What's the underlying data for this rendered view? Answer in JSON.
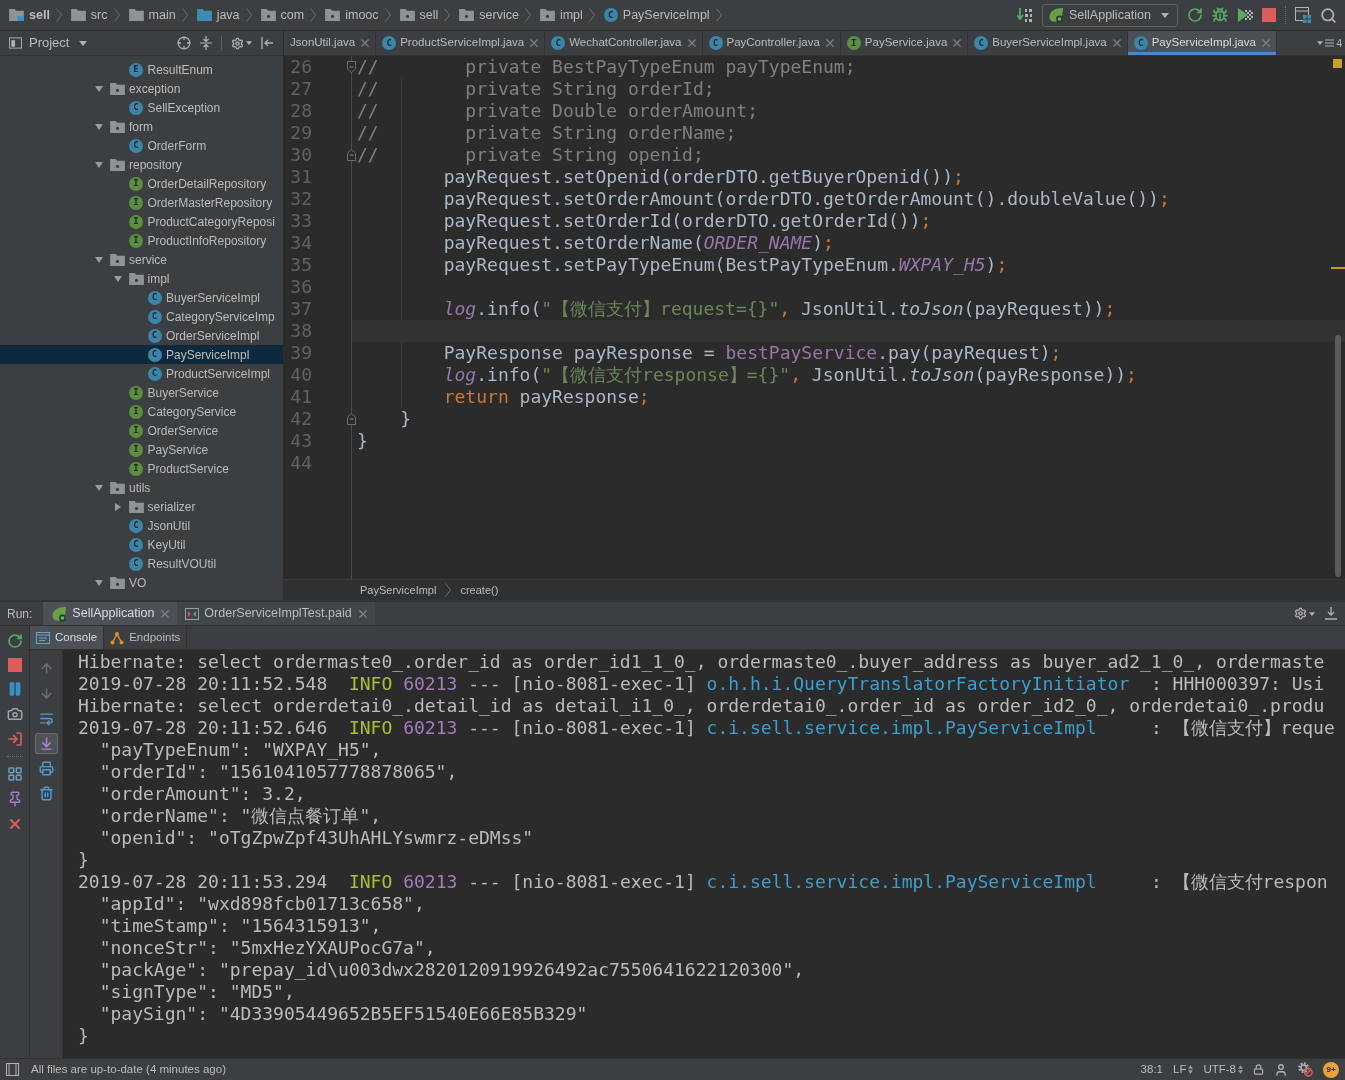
{
  "navigation_bar": {
    "breadcrumbs": [
      {
        "label": "sell",
        "kind": "module"
      },
      {
        "label": "src",
        "kind": "folder"
      },
      {
        "label": "main",
        "kind": "folder"
      },
      {
        "label": "java",
        "kind": "source_root"
      },
      {
        "label": "com",
        "kind": "package"
      },
      {
        "label": "imooc",
        "kind": "package"
      },
      {
        "label": "sell",
        "kind": "package"
      },
      {
        "label": "service",
        "kind": "package"
      },
      {
        "label": "impl",
        "kind": "package"
      },
      {
        "label": "PayServiceImpl",
        "kind": "class",
        "letter": "C"
      }
    ],
    "run_configuration": "SellApplication"
  },
  "project_panel": {
    "title": "Project",
    "tree": [
      {
        "children": [
          {
            "label": "ResultEnum",
            "kind": "enum",
            "letter": "E",
            "selected": false
          }
        ]
      },
      {
        "label": "exception",
        "kind": "package",
        "expanded": true,
        "selected": false,
        "children": [
          {
            "label": "SellException",
            "kind": "class",
            "letter": "C",
            "selected": false
          }
        ]
      },
      {
        "label": "form",
        "kind": "package",
        "expanded": true,
        "selected": false,
        "children": [
          {
            "label": "OrderForm",
            "kind": "class",
            "letter": "C",
            "selected": false
          }
        ]
      },
      {
        "label": "repository",
        "kind": "package",
        "expanded": true,
        "selected": false,
        "children": [
          {
            "label": "OrderDetailRepository",
            "kind": "interface",
            "letter": "I",
            "selected": false
          },
          {
            "label": "OrderMasterRepository",
            "kind": "interface",
            "letter": "I",
            "selected": false
          },
          {
            "label": "ProductCategoryReposi",
            "kind": "interface",
            "letter": "I",
            "selected": false
          },
          {
            "label": "ProductInfoRepository",
            "kind": "interface",
            "letter": "I",
            "selected": false
          }
        ]
      },
      {
        "label": "service",
        "kind": "package",
        "expanded": true,
        "selected": false,
        "children": [
          {
            "label": "impl",
            "kind": "package",
            "expanded": true,
            "selected": false,
            "children": [
              {
                "label": "BuyerServiceImpl",
                "kind": "class",
                "letter": "C",
                "selected": false
              },
              {
                "label": "CategoryServiceImp",
                "kind": "class",
                "letter": "C",
                "selected": false
              },
              {
                "label": "OrderServiceImpl",
                "kind": "class",
                "letter": "C",
                "selected": false
              },
              {
                "label": "PayServiceImpl",
                "kind": "class",
                "letter": "C",
                "selected": true
              },
              {
                "label": "ProductServiceImpl",
                "kind": "class",
                "letter": "C",
                "selected": false
              }
            ]
          },
          {
            "label": "BuyerService",
            "kind": "interface",
            "letter": "I",
            "selected": false
          },
          {
            "label": "CategoryService",
            "kind": "interface",
            "letter": "I",
            "selected": false
          },
          {
            "label": "OrderService",
            "kind": "interface",
            "letter": "I",
            "selected": false
          },
          {
            "label": "PayService",
            "kind": "interface",
            "letter": "I",
            "selected": false
          },
          {
            "label": "ProductService",
            "kind": "interface",
            "letter": "I",
            "selected": false
          }
        ]
      },
      {
        "label": "utils",
        "kind": "package",
        "expanded": true,
        "selected": false,
        "children": [
          {
            "label": "serializer",
            "kind": "package",
            "expanded": false,
            "selected": false
          },
          {
            "label": "JsonUtil",
            "kind": "class",
            "letter": "C",
            "selected": false
          },
          {
            "label": "KeyUtil",
            "kind": "class",
            "letter": "C",
            "selected": false
          },
          {
            "label": "ResultVOUtil",
            "kind": "class",
            "letter": "C",
            "selected": false
          }
        ]
      },
      {
        "label": "VO",
        "kind": "package",
        "expanded": true,
        "selected": false
      }
    ]
  },
  "editor": {
    "tabs": [
      {
        "label": "JsonUtil.java",
        "selected": false
      },
      {
        "label": "ProductServiceImpl.java",
        "kind": "class",
        "letter": "C",
        "selected": false
      },
      {
        "label": "WechatController.java",
        "kind": "class",
        "letter": "C",
        "selected": false
      },
      {
        "label": "PayController.java",
        "kind": "class",
        "letter": "C",
        "selected": false
      },
      {
        "label": "PayService.java",
        "kind": "interface",
        "letter": "I",
        "selected": false
      },
      {
        "label": "BuyerServiceImpl.java",
        "kind": "class",
        "letter": "C",
        "selected": false
      },
      {
        "label": "PayServiceImpl.java",
        "kind": "class",
        "letter": "C",
        "selected": true
      }
    ],
    "overflow_count": "4",
    "lines": [
      {
        "number": "26",
        "kind": "fold_start",
        "current": false,
        "tokens": [
          {
            "text": "//        private BestPayTypeEnum payTypeEnum;",
            "kind": "comment"
          }
        ]
      },
      {
        "number": "27",
        "kind": "code",
        "current": false,
        "tokens": [
          {
            "text": "//        private String orderId;",
            "kind": "comment"
          }
        ]
      },
      {
        "number": "28",
        "kind": "code",
        "current": false,
        "tokens": [
          {
            "text": "//        private Double orderAmount;",
            "kind": "comment"
          }
        ]
      },
      {
        "number": "29",
        "kind": "code",
        "current": false,
        "tokens": [
          {
            "text": "//        private String orderName;",
            "kind": "comment"
          }
        ]
      },
      {
        "number": "30",
        "kind": "fold_end",
        "current": false,
        "tokens": [
          {
            "text": "//        private String openid;",
            "kind": "comment"
          }
        ]
      },
      {
        "number": "31",
        "kind": "code",
        "current": false,
        "tokens": [
          {
            "text": "        payRequest.setOpenid(orderDTO.getBuyerOpenid())",
            "kind": "plain"
          },
          {
            "text": ";",
            "kind": "keyword"
          }
        ]
      },
      {
        "number": "32",
        "kind": "code",
        "current": false,
        "tokens": [
          {
            "text": "        payRequest.setOrderAmount(orderDTO.getOrderAmount().doubleValue())",
            "kind": "plain"
          },
          {
            "text": ";",
            "kind": "keyword"
          }
        ]
      },
      {
        "number": "33",
        "kind": "code",
        "current": false,
        "tokens": [
          {
            "text": "        payRequest.setOrderId(orderDTO.getOrderId())",
            "kind": "plain"
          },
          {
            "text": ";",
            "kind": "keyword"
          }
        ]
      },
      {
        "number": "34",
        "kind": "code",
        "current": false,
        "tokens": [
          {
            "text": "        payRequest.setOrderName(",
            "kind": "plain"
          },
          {
            "text": "ORDER_NAME",
            "kind": "static_field"
          },
          {
            "text": ")",
            "kind": "plain"
          },
          {
            "text": ";",
            "kind": "keyword"
          }
        ]
      },
      {
        "number": "35",
        "kind": "code",
        "current": false,
        "tokens": [
          {
            "text": "        payRequest.setPayTypeEnum(BestPayTypeEnum.",
            "kind": "plain"
          },
          {
            "text": "WXPAY_H5",
            "kind": "static_field"
          },
          {
            "text": ")",
            "kind": "plain"
          },
          {
            "text": ";",
            "kind": "keyword"
          }
        ]
      },
      {
        "number": "36",
        "kind": "code",
        "current": false
      },
      {
        "number": "37",
        "kind": "code",
        "current": false,
        "tokens": [
          {
            "text": "        log",
            "kind": "static_field"
          },
          {
            "text": ".info(",
            "kind": "plain"
          },
          {
            "text": "\"【微信支付】request={}\"",
            "kind": "string"
          },
          {
            "text": ",",
            "kind": "keyword"
          },
          {
            "text": " JsonUtil.",
            "kind": "plain"
          },
          {
            "text": "toJson",
            "kind": "static_method"
          },
          {
            "text": "(payRequest))",
            "kind": "plain"
          },
          {
            "text": ";",
            "kind": "keyword"
          }
        ]
      },
      {
        "number": "38",
        "kind": "code",
        "current": true
      },
      {
        "number": "39",
        "kind": "code",
        "current": false,
        "tokens": [
          {
            "text": "        PayResponse payResponse = ",
            "kind": "plain"
          },
          {
            "text": "bestPayService",
            "kind": "field"
          },
          {
            "text": ".pay(payRequest)",
            "kind": "plain"
          },
          {
            "text": ";",
            "kind": "keyword"
          }
        ]
      },
      {
        "number": "40",
        "kind": "code",
        "current": false,
        "tokens": [
          {
            "text": "        log",
            "kind": "static_field"
          },
          {
            "text": ".info(",
            "kind": "plain"
          },
          {
            "text": "\"【微信支付response】={}\"",
            "kind": "string"
          },
          {
            "text": ",",
            "kind": "keyword"
          },
          {
            "text": " JsonUtil.",
            "kind": "plain"
          },
          {
            "text": "toJson",
            "kind": "static_method"
          },
          {
            "text": "(payResponse))",
            "kind": "plain"
          },
          {
            "text": ";",
            "kind": "keyword"
          }
        ]
      },
      {
        "number": "41",
        "kind": "code",
        "current": false,
        "tokens": [
          {
            "text": "        return",
            "kind": "keyword"
          },
          {
            "text": " payResponse",
            "kind": "plain"
          },
          {
            "text": ";",
            "kind": "keyword"
          }
        ]
      },
      {
        "number": "42",
        "kind": "fold_end",
        "current": false,
        "tokens": [
          {
            "text": "    }",
            "kind": "plain"
          }
        ]
      },
      {
        "number": "43",
        "kind": "code",
        "current": false,
        "tokens": [
          {
            "text": "}",
            "kind": "plain"
          }
        ]
      },
      {
        "number": "44",
        "kind": "code",
        "current": false
      }
    ],
    "breadcrumb": [
      "PayServiceImpl",
      "create()"
    ]
  },
  "run_panel": {
    "title": "Run:",
    "tabs": [
      {
        "label": "SellApplication",
        "kind": "spring",
        "selected": true
      },
      {
        "label": "OrderServiceImplTest.paid",
        "kind": "test",
        "selected": false
      }
    ],
    "tool_tabs": [
      {
        "label": "Console",
        "kind": "console",
        "selected": true
      },
      {
        "label": "Endpoints",
        "kind": "endpoints",
        "selected": false
      }
    ],
    "console_tools": [
      {
        "kind": "up",
        "disabled": true,
        "on": false
      },
      {
        "kind": "down",
        "disabled": true,
        "on": false
      },
      {
        "kind": "wrap",
        "disabled": false,
        "on": false
      },
      {
        "kind": "scroll_end",
        "disabled": false,
        "on": true
      },
      {
        "kind": "print",
        "disabled": false,
        "on": false
      },
      {
        "kind": "clear",
        "disabled": false,
        "on": false
      }
    ],
    "console_lines": [
      {
        "tokens": [
          {
            "text": "Hibernate: select ordermaste0_.order_id as order_id1_1_0_, ordermaste0_.buyer_address as buyer_ad2_1_0_, ordermaste",
            "kind": "plain"
          }
        ]
      },
      {
        "tokens": [
          {
            "text": "2019-07-28 20:11:52.548  ",
            "kind": "plain"
          },
          {
            "text": "INFO",
            "kind": "level"
          },
          {
            "text": " 60213",
            "kind": "pid"
          },
          {
            "text": " --- [nio-8081-exec-1] ",
            "kind": "plain"
          },
          {
            "text": "o.h.h.i.QueryTranslatorFactoryInitiator",
            "kind": "logger"
          },
          {
            "text": "  : HHH000397: Usi",
            "kind": "plain"
          }
        ]
      },
      {
        "tokens": [
          {
            "text": "Hibernate: select orderdetai0_.detail_id as detail_i1_0_, orderdetai0_.order_id as order_id2_0_, orderdetai0_.produ",
            "kind": "plain"
          }
        ]
      },
      {
        "tokens": [
          {
            "text": "2019-07-28 20:11:52.646  ",
            "kind": "plain"
          },
          {
            "text": "INFO",
            "kind": "level"
          },
          {
            "text": " 60213",
            "kind": "pid"
          },
          {
            "text": " --- [nio-8081-exec-1] ",
            "kind": "plain"
          },
          {
            "text": "c.i.sell.service.impl.PayServiceImpl",
            "kind": "logger"
          },
          {
            "text": "     : 【微信支付】reque",
            "kind": "plain"
          }
        ]
      },
      {
        "tokens": [
          {
            "text": "  \"payTypeEnum\": \"WXPAY_H5\",",
            "kind": "plain"
          }
        ]
      },
      {
        "tokens": [
          {
            "text": "  \"orderId\": \"1561041057778878065\",",
            "kind": "plain"
          }
        ]
      },
      {
        "tokens": [
          {
            "text": "  \"orderAmount\": 3.2,",
            "kind": "plain"
          }
        ]
      },
      {
        "tokens": [
          {
            "text": "  \"orderName\": \"微信点餐订单\",",
            "kind": "plain"
          }
        ]
      },
      {
        "tokens": [
          {
            "text": "  \"openid\": \"oTgZpwZpf43UhAHLYswmrz-eDMss\"",
            "kind": "plain"
          }
        ]
      },
      {
        "tokens": [
          {
            "text": "}",
            "kind": "plain"
          }
        ]
      },
      {
        "tokens": [
          {
            "text": "2019-07-28 20:11:53.294  ",
            "kind": "plain"
          },
          {
            "text": "INFO",
            "kind": "level"
          },
          {
            "text": " 60213",
            "kind": "pid"
          },
          {
            "text": " --- [nio-8081-exec-1] ",
            "kind": "plain"
          },
          {
            "text": "c.i.sell.service.impl.PayServiceImpl",
            "kind": "logger"
          },
          {
            "text": "     : 【微信支付respon",
            "kind": "plain"
          }
        ]
      },
      {
        "tokens": [
          {
            "text": "  \"appId\": \"wxd898fcb01713c658\",",
            "kind": "plain"
          }
        ]
      },
      {
        "tokens": [
          {
            "text": "  \"timeStamp\": \"1564315913\",",
            "kind": "plain"
          }
        ]
      },
      {
        "tokens": [
          {
            "text": "  \"nonceStr\": \"5mxHezYXAUPocG7a\",",
            "kind": "plain"
          }
        ]
      },
      {
        "tokens": [
          {
            "text": "  \"packAge\": \"prepay_id\\u003dwx2820120919926492ac7550641622120300\",",
            "kind": "plain"
          }
        ]
      },
      {
        "tokens": [
          {
            "text": "  \"signType\": \"MD5\",",
            "kind": "plain"
          }
        ]
      },
      {
        "tokens": [
          {
            "text": "  \"paySign\": \"4D33905449652B5EF51540E66E85B329\"",
            "kind": "plain"
          }
        ]
      },
      {
        "tokens": [
          {
            "text": "}",
            "kind": "plain"
          }
        ]
      }
    ]
  },
  "status_bar": {
    "message": "All files are up-to-date (4 minutes ago)",
    "caret_position": "38:1",
    "line_separator": "LF",
    "encoding": "UTF-8",
    "event_count": "9+"
  }
}
